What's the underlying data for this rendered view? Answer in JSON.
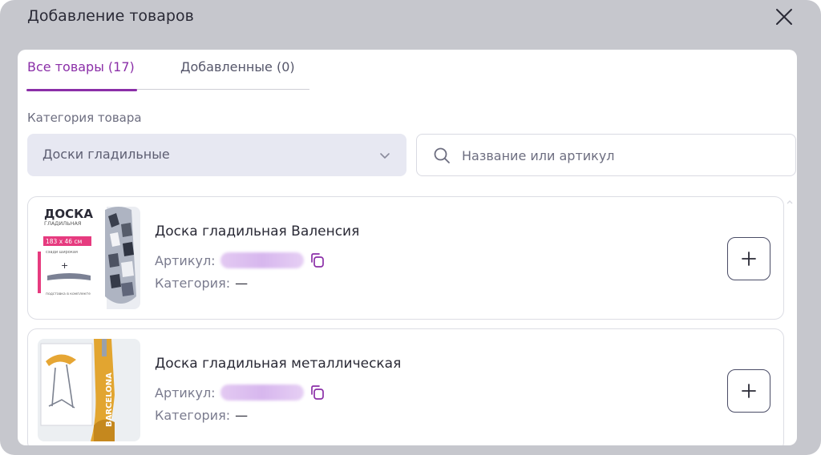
{
  "modal": {
    "title": "Добавление товаров"
  },
  "tabs": [
    {
      "label": "Все товары (17)",
      "active": true
    },
    {
      "label": "Добавленные (0)",
      "active": false
    }
  ],
  "filter": {
    "category_label": "Категория товара",
    "category_value": "Доски гладильные",
    "search_placeholder": "Название или артикул"
  },
  "products": [
    {
      "name": "Доска гладильная Валенсия",
      "sku_label": "Артикул:",
      "category_label": "Категория:",
      "category_value": "—",
      "thumb_text": {
        "title": "ДОСКА",
        "subtitle": "ГЛАДИЛЬНАЯ",
        "size": "183 х 46 см",
        "note1": "сзади широкая",
        "plus": "+",
        "note2": "подставка в комплекте"
      }
    },
    {
      "name": "Доска гладильная металлическая",
      "sku_label": "Артикул:",
      "category_label": "Категория:",
      "category_value": "—",
      "thumb_text": {
        "brand": "BARCELONA"
      }
    }
  ],
  "colors": {
    "accent": "#8b2fa8",
    "overlay": "#c6c7cd",
    "select_bg": "#e7e8f2"
  },
  "icons": [
    "close-icon",
    "chevron-down-icon",
    "search-icon",
    "copy-icon",
    "plus-icon"
  ]
}
